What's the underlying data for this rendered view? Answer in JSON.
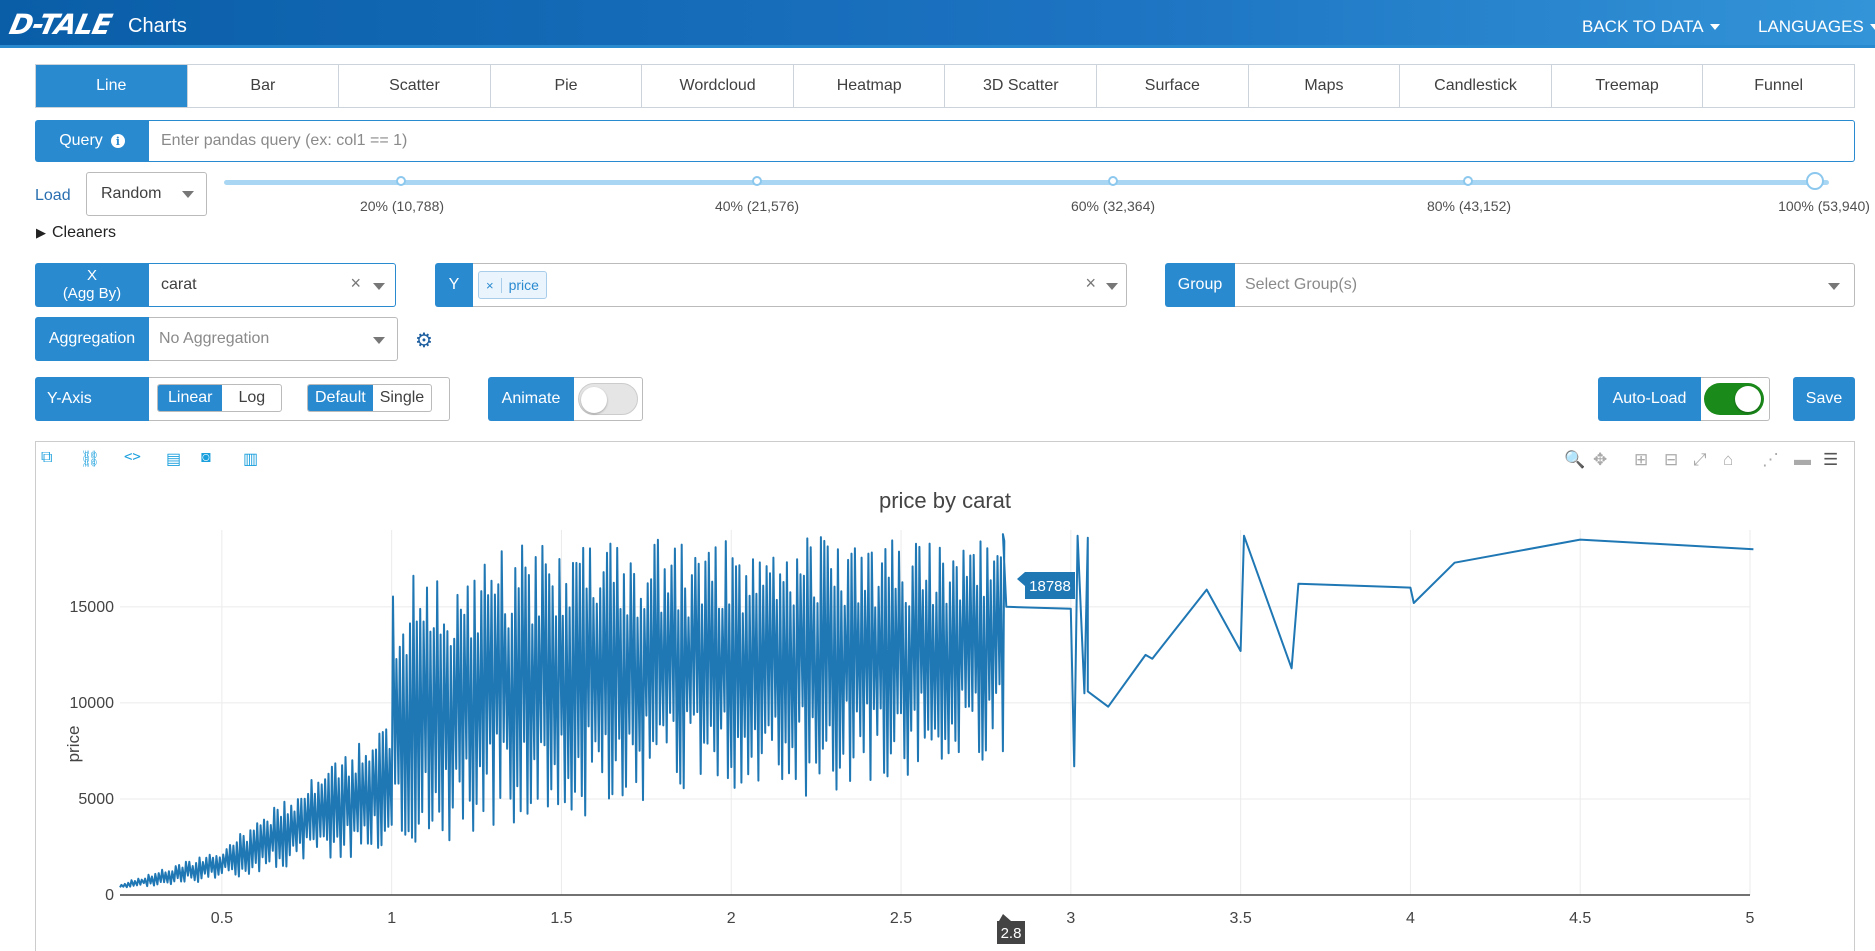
{
  "header": {
    "logo": "D-TALE",
    "title": "Charts",
    "back_to_data": "BACK TO DATA",
    "languages": "LANGUAGES"
  },
  "tabs": [
    {
      "label": "Line",
      "active": true
    },
    {
      "label": "Bar"
    },
    {
      "label": "Scatter"
    },
    {
      "label": "Pie"
    },
    {
      "label": "Wordcloud"
    },
    {
      "label": "Heatmap"
    },
    {
      "label": "3D Scatter"
    },
    {
      "label": "Surface"
    },
    {
      "label": "Maps"
    },
    {
      "label": "Candlestick"
    },
    {
      "label": "Treemap"
    },
    {
      "label": "Funnel"
    }
  ],
  "query": {
    "label": "Query",
    "placeholder": "Enter pandas query (ex: col1 == 1)"
  },
  "load": {
    "label": "Load",
    "selected": "Random",
    "slider_value_fraction": 1.0,
    "marks": [
      "20% (10,788)",
      "40% (21,576)",
      "60% (32,364)",
      "80% (43,152)",
      "100% (53,940)"
    ]
  },
  "cleaners": {
    "label": "Cleaners"
  },
  "x_axis": {
    "label_line1": "X",
    "label_line2": "(Agg By)",
    "value": "carat"
  },
  "y_axis_select": {
    "label": "Y",
    "tag": "price",
    "tag_remove": "×"
  },
  "group": {
    "label": "Group",
    "placeholder": "Select Group(s)"
  },
  "aggregation": {
    "label": "Aggregation",
    "placeholder": "No Aggregation"
  },
  "y_axis_type": {
    "label": "Y-Axis",
    "scale_options": [
      "Linear",
      "Log"
    ],
    "scale_selected": "Linear",
    "mode_options": [
      "Default",
      "Single"
    ],
    "mode_selected": "Default"
  },
  "animate": {
    "label": "Animate",
    "on": false
  },
  "auto_load": {
    "label": "Auto-Load",
    "on": true
  },
  "save": {
    "label": "Save"
  },
  "chart_toolbar_icons": [
    "popup-icon",
    "link-icon",
    "code-icon",
    "export-code-icon",
    "camera-icon",
    "csv-icon"
  ],
  "modebar_icons": [
    "zoom-icon",
    "pan-icon",
    "zoom-in-icon",
    "zoom-out-icon",
    "autoscale-icon",
    "home-icon",
    "spike-lines-icon",
    "hover-closest-icon",
    "hover-compare-icon"
  ],
  "hover": {
    "y_label": "18788",
    "x_label": "2.8"
  },
  "colors": {
    "accent": "#2a8ad0",
    "line": "#1f77b4",
    "toggle_on": "#1a8a1a"
  },
  "chart_data": {
    "type": "line",
    "title": "price by carat",
    "xlabel": "",
    "ylabel": "price",
    "xlim": [
      0.2,
      5.0
    ],
    "ylim": [
      0,
      19000
    ],
    "x_ticks": [
      "0.5",
      "1",
      "1.5",
      "2",
      "2.5",
      "3",
      "3.5",
      "4",
      "4.5",
      "5"
    ],
    "y_ticks": [
      "0",
      "5000",
      "10000",
      "15000"
    ],
    "grid": true,
    "series": [
      {
        "values": [
          [
            2.8,
            18788
          ],
          [
            2.81,
            15000
          ],
          [
            3.0,
            14900
          ],
          [
            3.01,
            6700
          ],
          [
            3.02,
            18700
          ],
          [
            3.04,
            10500
          ],
          [
            3.05,
            18600
          ],
          [
            3.05,
            10600
          ],
          [
            3.11,
            9800
          ],
          [
            3.22,
            12500
          ],
          [
            3.24,
            12300
          ],
          [
            3.4,
            15900
          ],
          [
            3.5,
            12700
          ],
          [
            3.51,
            18700
          ],
          [
            3.65,
            11800
          ],
          [
            3.67,
            16200
          ],
          [
            4.0,
            16000
          ],
          [
            4.01,
            15200
          ],
          [
            4.13,
            17300
          ],
          [
            4.5,
            18500
          ],
          [
            5.01,
            18000
          ]
        ]
      }
    ]
  }
}
